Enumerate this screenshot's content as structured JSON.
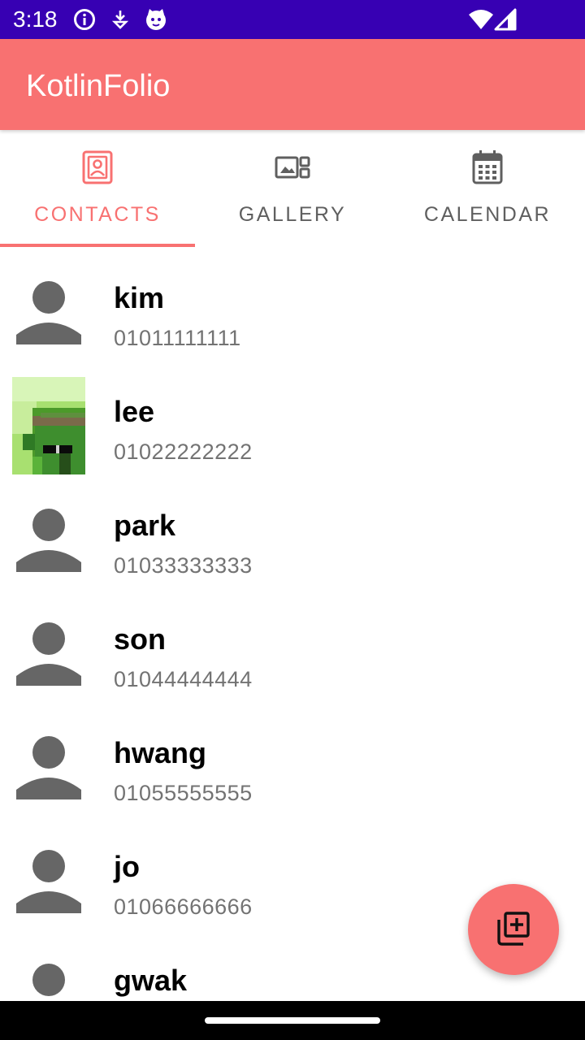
{
  "status_bar": {
    "time": "3:18",
    "icons": [
      "info-icon",
      "download-icon",
      "cat-icon",
      "wifi-icon",
      "signal-icon"
    ],
    "color": "#3700B3"
  },
  "app_bar": {
    "title": "KotlinFolio",
    "color": "#F87171"
  },
  "tabs": [
    {
      "label": "CONTACTS",
      "icon": "contacts-icon",
      "active": true
    },
    {
      "label": "GALLERY",
      "icon": "gallery-icon",
      "active": false
    },
    {
      "label": "CALENDAR",
      "icon": "calendar-icon",
      "active": false
    }
  ],
  "contacts": [
    {
      "name": "kim",
      "phone": "01011111111",
      "avatar": "person-icon"
    },
    {
      "name": "lee",
      "phone": "01022222222",
      "avatar": "pixel-photo"
    },
    {
      "name": "park",
      "phone": "01033333333",
      "avatar": "person-icon"
    },
    {
      "name": "son",
      "phone": "01044444444",
      "avatar": "person-icon"
    },
    {
      "name": "hwang",
      "phone": "01055555555",
      "avatar": "person-icon"
    },
    {
      "name": "jo",
      "phone": "01066666666",
      "avatar": "person-icon"
    },
    {
      "name": "gwak",
      "phone": "",
      "avatar": "person-icon"
    }
  ],
  "fab": {
    "icon": "add-to-library-icon"
  },
  "colors": {
    "accent": "#F87171",
    "tab_inactive": "#5f5f5f",
    "phone_text": "#737373",
    "avatar_gray": "#666666"
  }
}
